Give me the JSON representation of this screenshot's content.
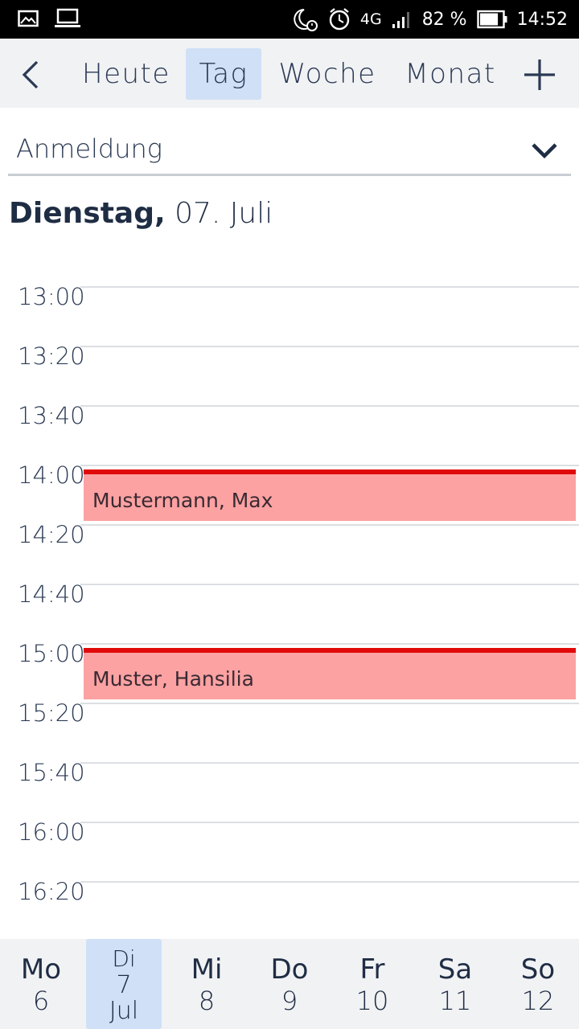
{
  "status_bar": {
    "network": "4G",
    "battery_percent": "82 %",
    "battery_level": 0.82,
    "time": "14:52",
    "icons": [
      "image-icon",
      "laptop-icon",
      "moon-alarm-icon",
      "alarm-icon",
      "signal-icon",
      "battery-icon"
    ]
  },
  "toolbar": {
    "today_label": "Heute",
    "day_label": "Tag",
    "week_label": "Woche",
    "month_label": "Monat",
    "active_view": "Tag"
  },
  "calendar_select": {
    "value": "Anmeldung"
  },
  "date_heading": {
    "weekday": "Dienstag,",
    "date": "07. Juli"
  },
  "timeslots": [
    "13:00",
    "13:20",
    "13:40",
    "14:00",
    "14:20",
    "14:40",
    "15:00",
    "15:20",
    "15:40",
    "16:00",
    "16:20"
  ],
  "events": [
    {
      "title": "Mustermann, Max",
      "start": "14:00"
    },
    {
      "title": "Muster, Hansilia",
      "start": "15:00"
    }
  ],
  "week": [
    {
      "name": "Mo",
      "num": "6"
    },
    {
      "name": "Di",
      "num": "7",
      "month": "Jul",
      "selected": true
    },
    {
      "name": "Mi",
      "num": "8"
    },
    {
      "name": "Do",
      "num": "9"
    },
    {
      "name": "Fr",
      "num": "10"
    },
    {
      "name": "Sa",
      "num": "11"
    },
    {
      "name": "So",
      "num": "12"
    }
  ],
  "colors": {
    "accent_selected": "#cfe0f7",
    "event_fill": "#fca2a2",
    "event_bar": "#e10a0a",
    "text_primary": "#1f2d44"
  }
}
